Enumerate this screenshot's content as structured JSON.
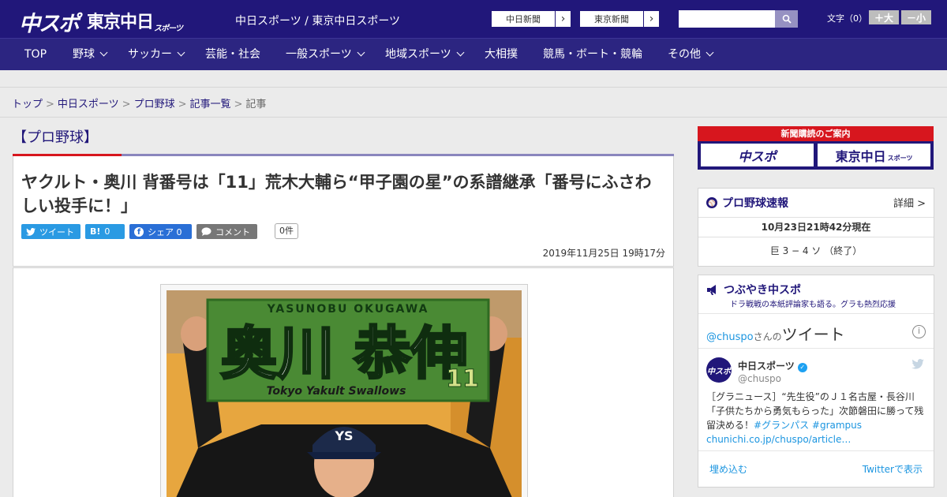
{
  "header": {
    "logo_chuspo": "中スポ",
    "logo_tokyo": "東京中日",
    "logo_tokyo_sub": "スポーツ",
    "site_links": "中日スポーツ / 東京中日スポーツ",
    "news_buttons": [
      {
        "label": "中日新聞",
        "arrow": "›"
      },
      {
        "label": "東京新聞",
        "arrow": "›"
      }
    ],
    "search": {
      "placeholder": "",
      "icon": "search-icon"
    },
    "font_size_label": "文字（0）",
    "font_plus": "＋大",
    "font_minus": "－小"
  },
  "nav": {
    "items": [
      {
        "label": "TOP",
        "has_dropdown": false
      },
      {
        "label": "野球",
        "has_dropdown": true
      },
      {
        "label": "サッカー",
        "has_dropdown": true
      },
      {
        "label": "芸能・社会",
        "has_dropdown": false
      },
      {
        "label": "一般スポーツ",
        "has_dropdown": true
      },
      {
        "label": "地域スポーツ",
        "has_dropdown": true
      },
      {
        "label": "大相撲",
        "has_dropdown": false
      },
      {
        "label": "競馬・ボート・競輪",
        "has_dropdown": false
      },
      {
        "label": "その他",
        "has_dropdown": true
      }
    ]
  },
  "breadcrumb": {
    "items": [
      "トップ",
      "中日スポーツ",
      "プロ野球",
      "記事一覧",
      "記事"
    ],
    "separator": ">"
  },
  "article": {
    "category": "【プロ野球】",
    "headline": "ヤクルト・奥川 背番号は「11」荒木大輔ら“甲子園の星”の系譜継承「番号にふさわしい投手に！」",
    "share": {
      "tweet": "ツイート",
      "hatena_label": "B!",
      "hatena_count": "0",
      "facebook": "シェア 0",
      "comment": "コメント",
      "comment_count": "0件"
    },
    "date": "2019年11月25日 19時17分",
    "photo": {
      "towel_top": "YASUNOBU  OKUGAWA",
      "towel_name": "奥川 恭伸",
      "towel_bottom": "Tokyo Yakult Swallows",
      "towel_number": "11"
    }
  },
  "sidebar": {
    "promo": {
      "title": "新聞購読のご案内",
      "left": "中スポ",
      "right": "東京中日",
      "right_sub": "スポーツ"
    },
    "baseball": {
      "title": "プロ野球速報",
      "more": "詳細 >",
      "updated": "10月23日21時42分現在",
      "score": "巨 3 − 4 ソ （終了）"
    },
    "tweets": {
      "title": "つぶやき中スポ",
      "subtitle": "ドラ戦戦の本紙評論家も語る。グラも熱烈応援",
      "handle": "@chuspo",
      "san": "さんの",
      "big": "ツイート",
      "name": "中日スポーツ",
      "screen_name": "@chuspo",
      "text1": "［グラニュース］“先生役”のＪ１名古屋・長谷川「子供たちから勇気もらった」次節磐田に勝って残留決める！",
      "tag1": "#グランパス",
      "tag2": "#grampus",
      "link": "chunichi.co.jp/chuspo/article…",
      "embed": "埋め込む",
      "view": "Twitterで表示",
      "accent": "#1b95e0"
    }
  }
}
